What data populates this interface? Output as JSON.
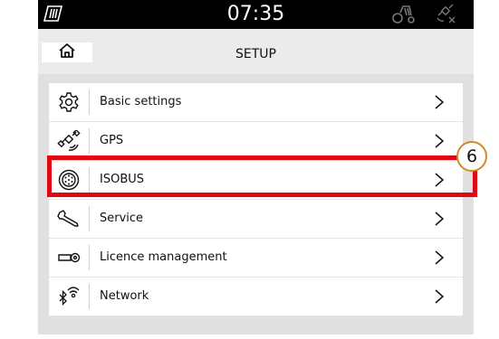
{
  "status_bar": {
    "time": "07:35",
    "icons": [
      "tablet-icon",
      "tractor-icon",
      "gps-off-icon"
    ]
  },
  "title_bar": {
    "title": "SETUP",
    "home_icon": "home-icon"
  },
  "menu": [
    {
      "label": "Basic settings",
      "icon": "gear-icon"
    },
    {
      "label": "GPS",
      "icon": "satellite-icon"
    },
    {
      "label": "ISOBUS",
      "icon": "isobus-connector-icon"
    },
    {
      "label": "Service",
      "icon": "wrench-icon"
    },
    {
      "label": "Licence management",
      "icon": "key-icon"
    },
    {
      "label": "Network",
      "icon": "bluetooth-wifi-icon"
    }
  ],
  "annotation": {
    "callout_number": "6",
    "highlight_color": "#e30613",
    "callout_color": "#d08a2a"
  }
}
